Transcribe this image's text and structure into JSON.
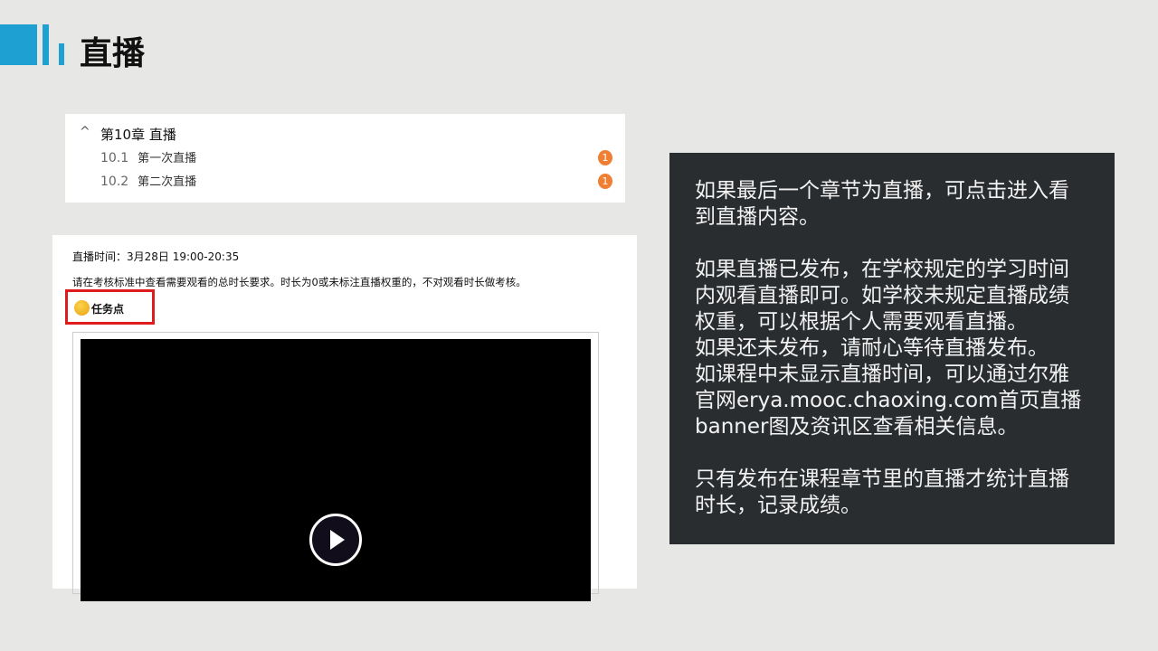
{
  "slide": {
    "title": "直播"
  },
  "chapter": {
    "title": "第10章 直播",
    "sections": [
      {
        "num": "10.1",
        "label": "第一次直播",
        "badge": "1"
      },
      {
        "num": "10.2",
        "label": "第二次直播",
        "badge": "1"
      }
    ]
  },
  "live": {
    "time": "直播时间：3月28日 19:00-20:35",
    "note": "请在考核标准中查看需要观看的总时长要求。时长为0或未标注直播权重的，不对观看时长做考核。",
    "task_label": "任务点"
  },
  "info": {
    "paragraphs": [
      "如果最后一个章节为直播，可点击进入看\n到直播内容。",
      "如果直播已发布，在学校规定的学习时间\n内观看直播即可。如学校未规定直播成绩\n权重，可以根据个人需要观看直播。\n如果还未发布，请耐心等待直播发布。\n如课程中未显示直播时间，可以通过尔雅\n官网erya.mooc.chaoxing.com首页直播\nbanner图及资讯区查看相关信息。",
      "只有发布在课程章节里的直播才统计直播\n时长，记录成绩。"
    ]
  }
}
